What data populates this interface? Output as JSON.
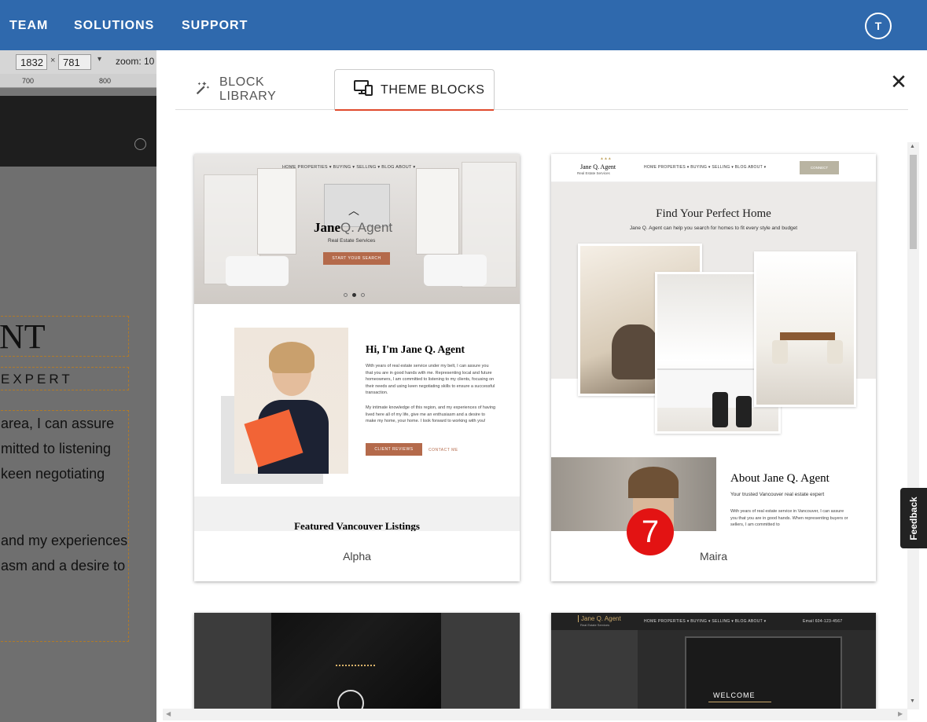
{
  "topbar": {
    "nav": [
      "TEAM",
      "SOLUTIONS",
      "SUPPORT"
    ],
    "avatar_initial": "T",
    "color": "#2f69ad"
  },
  "editor": {
    "width": "1832",
    "height": "781",
    "zoom_label": "zoom: 10",
    "ruler": [
      "700",
      "800"
    ],
    "heading_fragment": "NT",
    "subheading_fragment": "EXPERT",
    "para1": [
      "area, I can assure",
      "mitted to listening",
      "keen negotiating"
    ],
    "para2": [
      "and my experiences",
      "asm and a desire to"
    ]
  },
  "panel": {
    "tabs": [
      {
        "label": "BLOCK LIBRARY",
        "icon": "magic-wand-icon",
        "active": false
      },
      {
        "label": "THEME BLOCKS",
        "icon": "monitor-devices-icon",
        "active": true
      }
    ],
    "close_icon": "close-icon"
  },
  "cards": [
    {
      "name": "Alpha",
      "thumb": {
        "nav": "HOME   PROPERTIES ▾   BUYING ▾   SELLING ▾   BLOG   ABOUT ▾",
        "logo_bold": "Jane",
        "logo_light": "Q. Agent",
        "logo_sub": "Real Estate Services",
        "cta": "START YOUR SEARCH",
        "heading": "Hi, I'm Jane Q. Agent",
        "para1": "With years of real estate service under my belt, I can assure you that you are in good hands with me. Representing local and future homeowners, I am committed to listening to my clients, focusing on their needs and using keen negotiating skills to ensure a successful transaction.",
        "para2": "My intimate knowledge of this region, and my experiences of having lived here all of my life, give me an enthusiasm and a desire to make my home, your home. I look forward to working with you!",
        "btn1": "CLIENT REVIEWS",
        "btn2": "CONTACT ME",
        "featured": "Featured Vancouver Listings"
      }
    },
    {
      "name": "Maira",
      "thumb": {
        "logo": "Jane Q. Agent",
        "logo_sub": "Real Estate Services",
        "nav": "HOME   PROPERTIES ▾   BUYING ▾   SELLING ▾   BLOG   ABOUT ▾",
        "connect": "CONNECT",
        "heading": "Find Your Perfect Home",
        "sub": "Jane Q. Agent can help you search for homes to fit every style and budget",
        "about_heading": "About Jane Q. Agent",
        "about_sub": "Your trusted Vancouver real estate expert",
        "about_para": "With years of real estate service in Vancouver, I can assure you that you are in good hands. When representing buyers or sellers, I am committed to"
      }
    },
    {
      "name": "",
      "thumb": {}
    },
    {
      "name": "",
      "thumb": {
        "logo": "Jane Q. Agent",
        "logo_sub": "Real Estate Services",
        "nav": "HOME   PROPERTIES ▾   BUYING ▾   SELLING ▾   BLOG   ABOUT ▾",
        "contact": "Email   604-123-4567",
        "welcome": "WELCOME"
      }
    }
  ],
  "overlay": {
    "badge": "7",
    "feedback": "Feedback"
  }
}
